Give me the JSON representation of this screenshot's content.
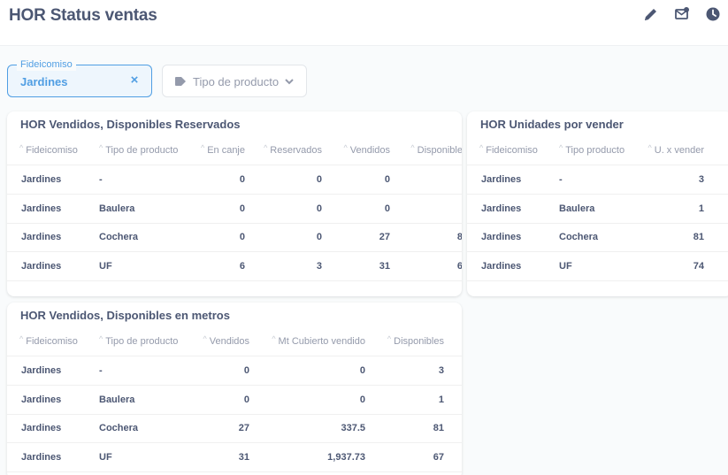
{
  "page": {
    "title": "HOR Status ventas"
  },
  "header_icons": [
    "pencil-icon",
    "mail-settings-icon",
    "clock-icon"
  ],
  "filters": {
    "fideicomiso": {
      "label": "Fideicomiso",
      "value": "Jardines",
      "clear": "×"
    },
    "tipo": {
      "label": "Tipo de producto"
    }
  },
  "cards": {
    "vendidos_reservados": {
      "title": "HOR Vendidos, Disponibles Reservados",
      "columns": [
        "Fideicomiso",
        "Tipo de producto",
        "En canje",
        "Reservados",
        "Vendidos",
        "Disponible"
      ],
      "rows": [
        [
          "Jardines",
          "-",
          "0",
          "0",
          "0",
          ""
        ],
        [
          "Jardines",
          "Baulera",
          "0",
          "0",
          "0",
          ""
        ],
        [
          "Jardines",
          "Cochera",
          "0",
          "0",
          "27",
          "8"
        ],
        [
          "Jardines",
          "UF",
          "6",
          "3",
          "31",
          "6"
        ]
      ]
    },
    "unidades": {
      "title": "HOR Unidades por vender",
      "columns": [
        "Fideicomiso",
        "Tipo producto",
        "U. x vender"
      ],
      "rows": [
        [
          "Jardines",
          "-",
          "3"
        ],
        [
          "Jardines",
          "Baulera",
          "1"
        ],
        [
          "Jardines",
          "Cochera",
          "81"
        ],
        [
          "Jardines",
          "UF",
          "74"
        ]
      ]
    },
    "metros": {
      "title": "HOR Vendidos, Disponibles en metros",
      "columns": [
        "Fideicomiso",
        "Tipo de producto",
        "Vendidos",
        "Mt Cubierto vendido",
        "Disponibles"
      ],
      "rows": [
        [
          "Jardines",
          "-",
          "0",
          "0",
          "3"
        ],
        [
          "Jardines",
          "Baulera",
          "0",
          "0",
          "1"
        ],
        [
          "Jardines",
          "Cochera",
          "27",
          "337.5",
          "81"
        ],
        [
          "Jardines",
          "UF",
          "31",
          "1,937.73",
          "67"
        ]
      ]
    }
  }
}
